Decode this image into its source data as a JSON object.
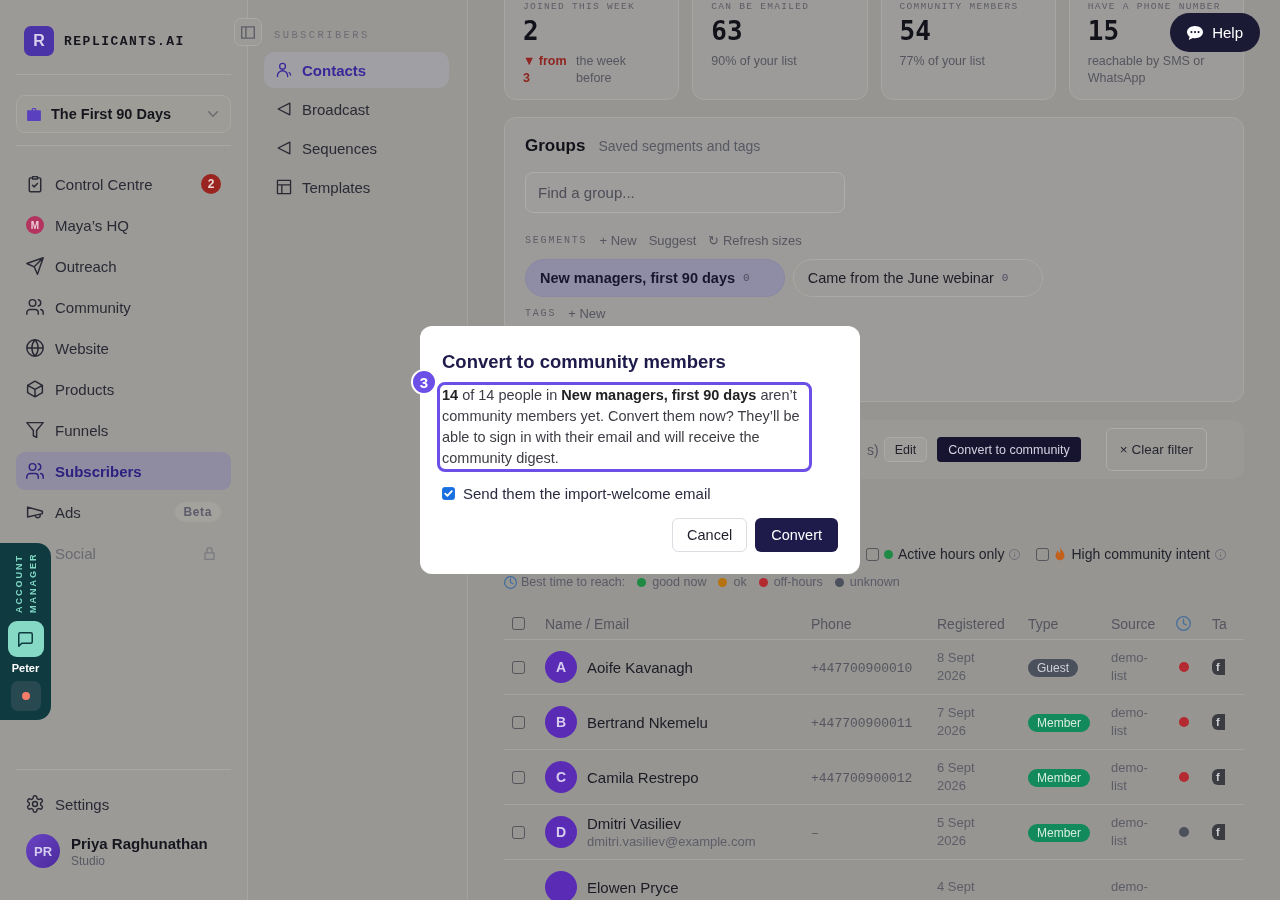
{
  "sidebar": {
    "logo": {
      "letter": "R",
      "wordmark": "REPLICANTS.AI"
    },
    "workspace": {
      "label": "The First 90 Days"
    },
    "nav": [
      {
        "label": "Control Centre",
        "selected": false,
        "disabled": false,
        "badge": "2"
      },
      {
        "label": "Maya’s HQ",
        "avatar": "M",
        "selected": false,
        "disabled": false
      },
      {
        "label": "Outreach",
        "selected": false,
        "disabled": false
      },
      {
        "label": "Community",
        "selected": false,
        "disabled": false
      },
      {
        "label": "Website",
        "selected": false,
        "disabled": false
      },
      {
        "label": "Products",
        "selected": false,
        "disabled": false
      },
      {
        "label": "Funnels",
        "selected": false,
        "disabled": false
      },
      {
        "label": "Subscribers",
        "selected": true,
        "disabled": false
      },
      {
        "label": "Ads",
        "selected": false,
        "disabled": false,
        "tag": "Beta"
      },
      {
        "label": "Social",
        "selected": false,
        "disabled": true
      }
    ],
    "settings": {
      "label": "Settings"
    },
    "user": {
      "initials": "PR",
      "name": "Priya Raghunathan",
      "plan": "Studio"
    }
  },
  "subnav": {
    "heading": "SUBSCRIBERS",
    "items": [
      {
        "label": "Contacts",
        "selected": true
      },
      {
        "label": "Broadcast",
        "selected": false
      },
      {
        "label": "Sequences",
        "selected": false
      },
      {
        "label": "Templates",
        "selected": false
      }
    ]
  },
  "help": {
    "label": "Help"
  },
  "account_manager": {
    "title": "ACCOUNT MANAGER",
    "name": "Peter"
  },
  "stats": [
    {
      "label": "JOINED THIS WEEK",
      "value": "2",
      "trend": {
        "text": "▼ from 3",
        "negative": true
      },
      "note": "the week before"
    },
    {
      "label": "CAN BE EMAILED",
      "value": "63",
      "note": "90% of your list"
    },
    {
      "label": "COMMUNITY MEMBERS",
      "value": "54",
      "note": "77% of your list"
    },
    {
      "label": "HAVE A PHONE NUMBER",
      "value": "15",
      "note": "reachable by SMS or WhatsApp"
    }
  ],
  "groups": {
    "title": "Groups",
    "subtitle": "Saved segments and tags",
    "search": {
      "placeholder": "Find a group..."
    },
    "segments": {
      "heading": "SEGMENTS",
      "actions": [
        "+ New",
        "Suggest",
        "↻ Refresh sizes"
      ],
      "items": [
        {
          "label": "New managers, first 90 days",
          "count": "0",
          "selected": true
        },
        {
          "label": "Came from the June webinar",
          "count": "0",
          "selected": false
        }
      ]
    },
    "tags": {
      "heading": "TAGS",
      "actions": [
        "+ New"
      ]
    }
  },
  "toolbar": {
    "summary": "s)",
    "buttons": [
      {
        "label": "Edit",
        "kind": "outline"
      },
      {
        "label": "Convert to community",
        "kind": "primary"
      },
      {
        "label": "× Clear filter",
        "kind": "clear"
      }
    ]
  },
  "filters": [
    {
      "label": "Active hours only",
      "checked": false,
      "kind": "dot"
    },
    {
      "label": "High community intent",
      "checked": false,
      "kind": "flame"
    }
  ],
  "reach_legend": {
    "label": "Best time to reach:",
    "items": [
      {
        "label": "good now",
        "color": "#1f8a43"
      },
      {
        "label": "ok",
        "color": "#b5730f"
      },
      {
        "label": "off-hours",
        "color": "#b32a30"
      },
      {
        "label": "unknown",
        "color": "#4b505c"
      }
    ]
  },
  "table": {
    "all_selected": false,
    "columns": [
      {
        "kind": "text",
        "label": "Name / Email"
      },
      {
        "kind": "text",
        "label": "Phone"
      },
      {
        "kind": "text",
        "label": "Registered"
      },
      {
        "kind": "text",
        "label": "Type"
      },
      {
        "kind": "text",
        "label": "Source"
      },
      {
        "kind": "icon"
      },
      {
        "kind": "text",
        "label": "Ta"
      }
    ],
    "rows": [
      {
        "selected": false,
        "initial": "A",
        "name": "Aoife Kavanagh",
        "phone": "+447700900010",
        "registered": "8 Sept 2026",
        "type": {
          "label": "Guest",
          "kind": "guest"
        },
        "source": "demo-list",
        "reach": {
          "color": "#b32a30"
        },
        "tag": "f"
      },
      {
        "selected": false,
        "initial": "B",
        "name": "Bertrand Nkemelu",
        "phone": "+447700900011",
        "registered": "7 Sept 2026",
        "type": {
          "label": "Member",
          "kind": "member"
        },
        "source": "demo-list",
        "reach": {
          "color": "#b32a30"
        },
        "tag": "f"
      },
      {
        "selected": false,
        "initial": "C",
        "name": "Camila Restrepo",
        "phone": "+447700900012",
        "registered": "6 Sept 2026",
        "type": {
          "label": "Member",
          "kind": "member"
        },
        "source": "demo-list",
        "reach": {
          "color": "#b32a30"
        },
        "tag": "f"
      },
      {
        "selected": false,
        "initial": "D",
        "name": "Dmitri Vasiliev",
        "email": "dmitri.vasiliev@example.com",
        "phone": "–",
        "registered": "5 Sept 2026",
        "type": {
          "label": "Member",
          "kind": "member"
        },
        "source": "demo-list",
        "reach": {
          "color": "#4b505c"
        },
        "tag": "f"
      },
      {
        "name": "Elowen Pryce",
        "registered": "4 Sept",
        "source": "demo-"
      }
    ]
  },
  "dialog": {
    "title": "Convert to community members",
    "step": "3",
    "message": "**14** of 14 people in **New managers, first 90 days** aren’t community members yet. Convert them now? They’ll be able to sign in with their email and will receive the community digest.",
    "option": {
      "label": "Send them the import-welcome email",
      "checked": true
    },
    "buttons": [
      {
        "label": "Cancel",
        "kind": "secondary"
      },
      {
        "label": "Convert",
        "kind": "primary"
      }
    ]
  }
}
